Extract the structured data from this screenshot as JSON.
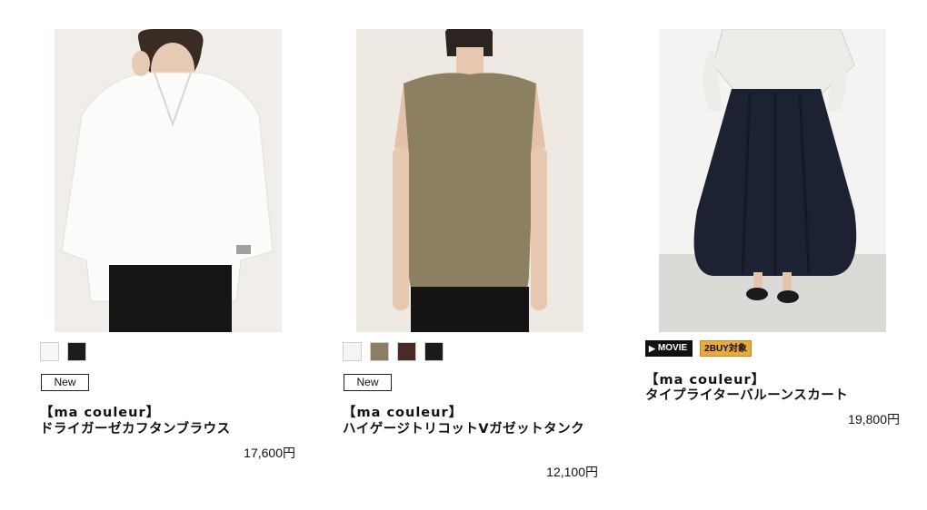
{
  "products": [
    {
      "brand": "【ma couleur】",
      "name": "ドライガーゼカフタンブラウス",
      "price": "17,600円",
      "badge": "New",
      "swatches": [
        "#f7f7f7",
        "#1c1c1c"
      ]
    },
    {
      "brand": "【ma couleur】",
      "name": "ハイゲージトリコットVガゼットタンク",
      "price": "12,100円",
      "badge": "New",
      "swatches": [
        "#f5f5f3",
        "#8c7e63",
        "#4a2a24",
        "#1a1a1a"
      ]
    },
    {
      "brand": "【ma couleur】",
      "name": "タイプライターバルーンスカート",
      "price": "19,800円",
      "movie_label": "MOVIE",
      "buy_label": "2BUY対象"
    }
  ]
}
